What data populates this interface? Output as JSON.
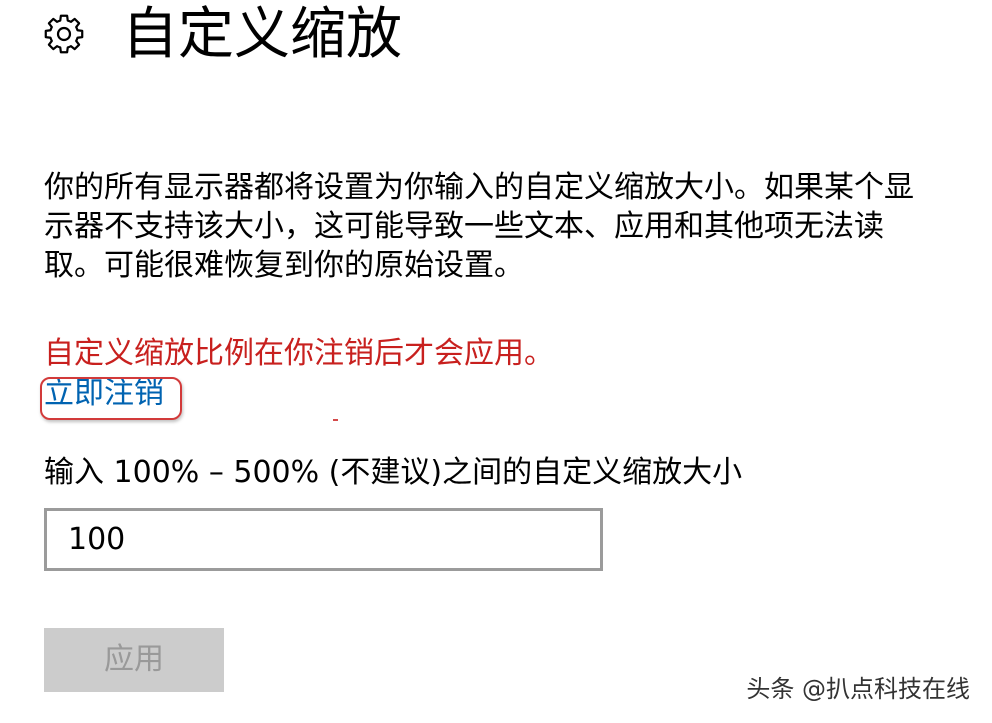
{
  "page": {
    "title": "自定义缩放"
  },
  "icons": {
    "header": "gear-icon"
  },
  "description": {
    "lines": [
      "你的所有显示器都将设置为你输入的自定义缩放大小。如果某个显",
      "示器不支持该大小，这可能导致一些文本、应用和其他项无法读",
      "取。可能很难恢复到你的原始设置。"
    ]
  },
  "warning": {
    "text": "自定义缩放比例在你注销后才会应用。"
  },
  "sign_out_link": {
    "label": "立即注销"
  },
  "scale_input": {
    "label": "输入 100% – 500% (不建议)之间的自定义缩放大小",
    "value": "100"
  },
  "apply_button": {
    "label": "应用",
    "disabled": true
  },
  "watermark": {
    "text": "头条 @扒点科技在线"
  },
  "colors": {
    "text": "#000000",
    "warning": "#c8201e",
    "link": "#0063b1",
    "annotation": "#d23a3a",
    "input_border": "#9b9b9b",
    "button_bg": "#cccccc",
    "button_text": "#999999"
  }
}
